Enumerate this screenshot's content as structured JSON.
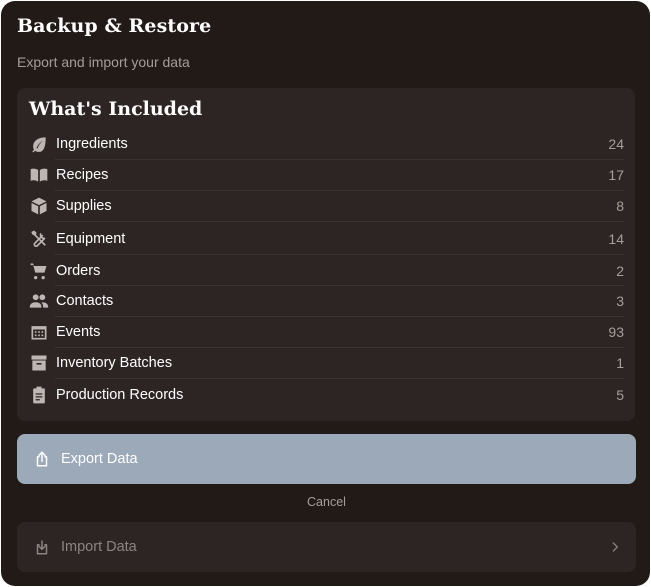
{
  "header": {
    "title": "Backup & Restore",
    "subtitle": "Export and import your data"
  },
  "included": {
    "title": "What's Included",
    "items": [
      {
        "label": "Ingredients",
        "count": "24",
        "icon": "leaf-icon"
      },
      {
        "label": "Recipes",
        "count": "17",
        "icon": "book-icon"
      },
      {
        "label": "Supplies",
        "count": "8",
        "icon": "box-icon"
      },
      {
        "label": "Equipment",
        "count": "14",
        "icon": "tools-icon"
      },
      {
        "label": "Orders",
        "count": "2",
        "icon": "cart-icon"
      },
      {
        "label": "Contacts",
        "count": "3",
        "icon": "people-icon"
      },
      {
        "label": "Events",
        "count": "93",
        "icon": "calendar-icon"
      },
      {
        "label": "Inventory Batches",
        "count": "1",
        "icon": "archive-icon"
      },
      {
        "label": "Production Records",
        "count": "5",
        "icon": "clipboard-icon"
      }
    ]
  },
  "actions": {
    "export_label": "Export Data",
    "cancel_label": "Cancel",
    "import_label": "Import Data"
  },
  "colors": {
    "background": "#221a17",
    "card": "#2d2523",
    "export_button": "#9ba9b9",
    "muted_text": "#a69e9a"
  }
}
